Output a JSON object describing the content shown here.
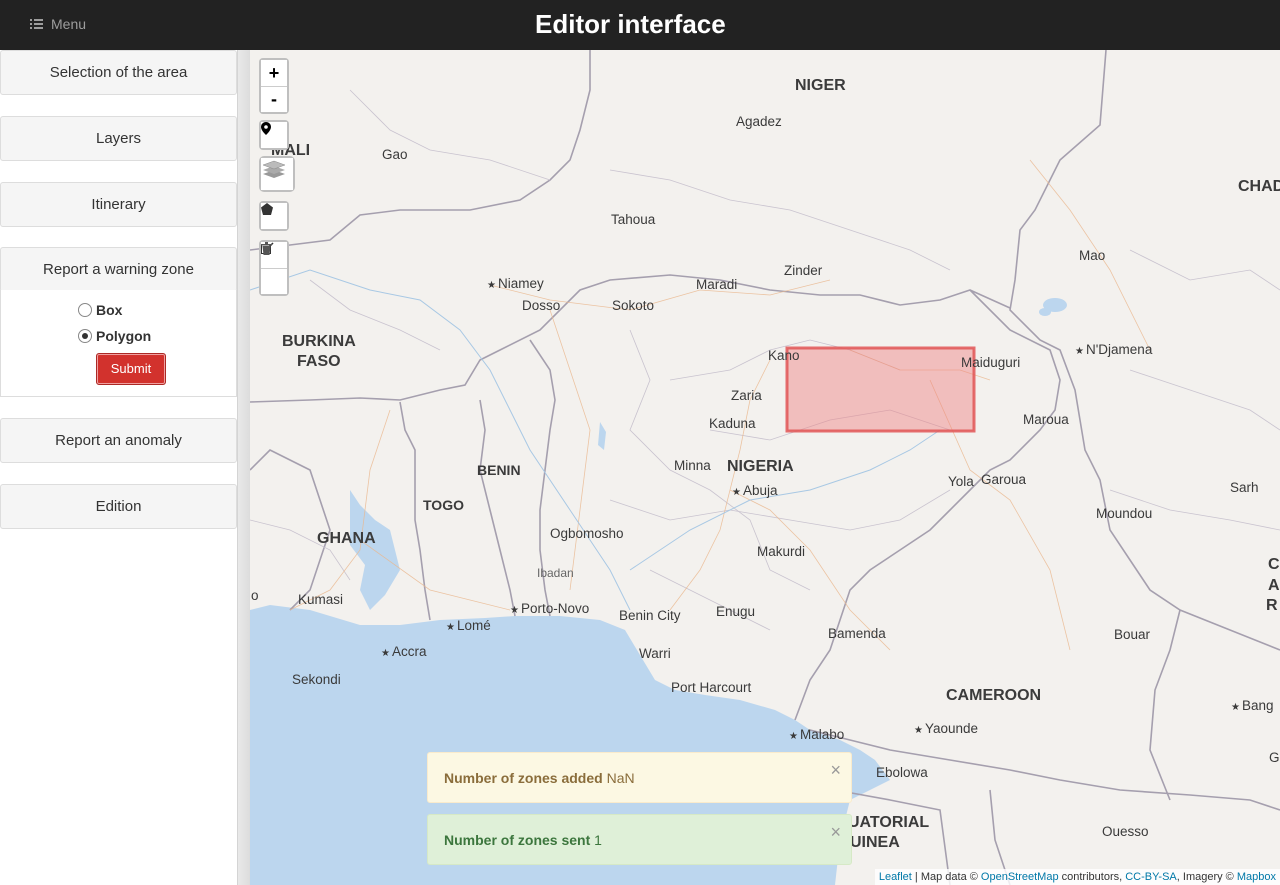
{
  "header": {
    "menu_label": "Menu",
    "title": "Editor interface"
  },
  "sidebar": {
    "selection": "Selection of the area",
    "layers": "Layers",
    "itinerary": "Itinerary",
    "warning_zone": "Report a warning zone",
    "options": [
      {
        "label": "Box",
        "selected": false
      },
      {
        "label": "Polygon",
        "selected": true
      }
    ],
    "submit": "Submit",
    "anomaly": "Report an anomaly",
    "edition": "Edition"
  },
  "map_controls": {
    "zoom_in": "+",
    "zoom_out": "-"
  },
  "map_labels": {
    "niger": "NIGER",
    "mali": "MALI",
    "chad": "CHAD",
    "burkina": "BURKINA",
    "faso": "FASO",
    "benin": "BENIN",
    "togo": "TOGO",
    "ghana": "GHANA",
    "nigeria": "NIGERIA",
    "cameroon": "CAMEROON",
    "equatorial": "UATORIAL",
    "guinea": "UINEA",
    "agadez": "Agadez",
    "gao": "Gao",
    "tahoua": "Tahoua",
    "zinder": "Zinder",
    "maradi": "Maradi",
    "mao": "Mao",
    "niamey": "Niamey",
    "dosso": "Dosso",
    "sokoto": "Sokoto",
    "kano": "Kano",
    "maiduguri": "Maiduguri",
    "ndjamena": "N'Djamena",
    "zaria": "Zaria",
    "kaduna": "Kaduna",
    "maroua": "Maroua",
    "minna": "Minna",
    "abuja": "Abuja",
    "yola": "Yola",
    "garoua": "Garoua",
    "sarh": "Sarh",
    "moundou": "Moundou",
    "ogbomosho": "Ogbomosho",
    "ibadan": "Ibadan",
    "makurdi": "Makurdi",
    "kumasi": "Kumasi",
    "porto_novo": "Porto-Novo",
    "lome": "Lomé",
    "benin_city": "Benin City",
    "enugu": "Enugu",
    "accra": "Accra",
    "warri": "Warri",
    "bamenda": "Bamenda",
    "bouar": "Bouar",
    "sekondi": "Sekondi",
    "port_harcourt": "Port Harcourt",
    "yaounde": "Yaounde",
    "bangui": "Bang",
    "malabo": "Malabo",
    "ebolowa": "Ebolowa",
    "ouesso": "Ouesso",
    "edge_o": "o",
    "edge_c": "C",
    "edge_a": "A",
    "edge_r": "R",
    "edge_g": "G"
  },
  "alerts": {
    "zones_added_label": "Number of zones added",
    "zones_added_value": "NaN",
    "zones_sent_label": "Number of zones sent",
    "zones_sent_value": "1",
    "close": "×"
  },
  "attribution": {
    "leaflet": "Leaflet",
    "map_data": " | Map data © ",
    "osm": "OpenStreetMap",
    "contributors": " contributors, ",
    "ccbysa": "CC-BY-SA",
    "imagery": ", Imagery © ",
    "mapbox": "Mapbox"
  },
  "colors": {
    "topbar": "#222222",
    "submit": "#d2322d",
    "zone_fill": "#f08080",
    "zone_stroke": "#e05555",
    "water": "#bcd6ee"
  }
}
